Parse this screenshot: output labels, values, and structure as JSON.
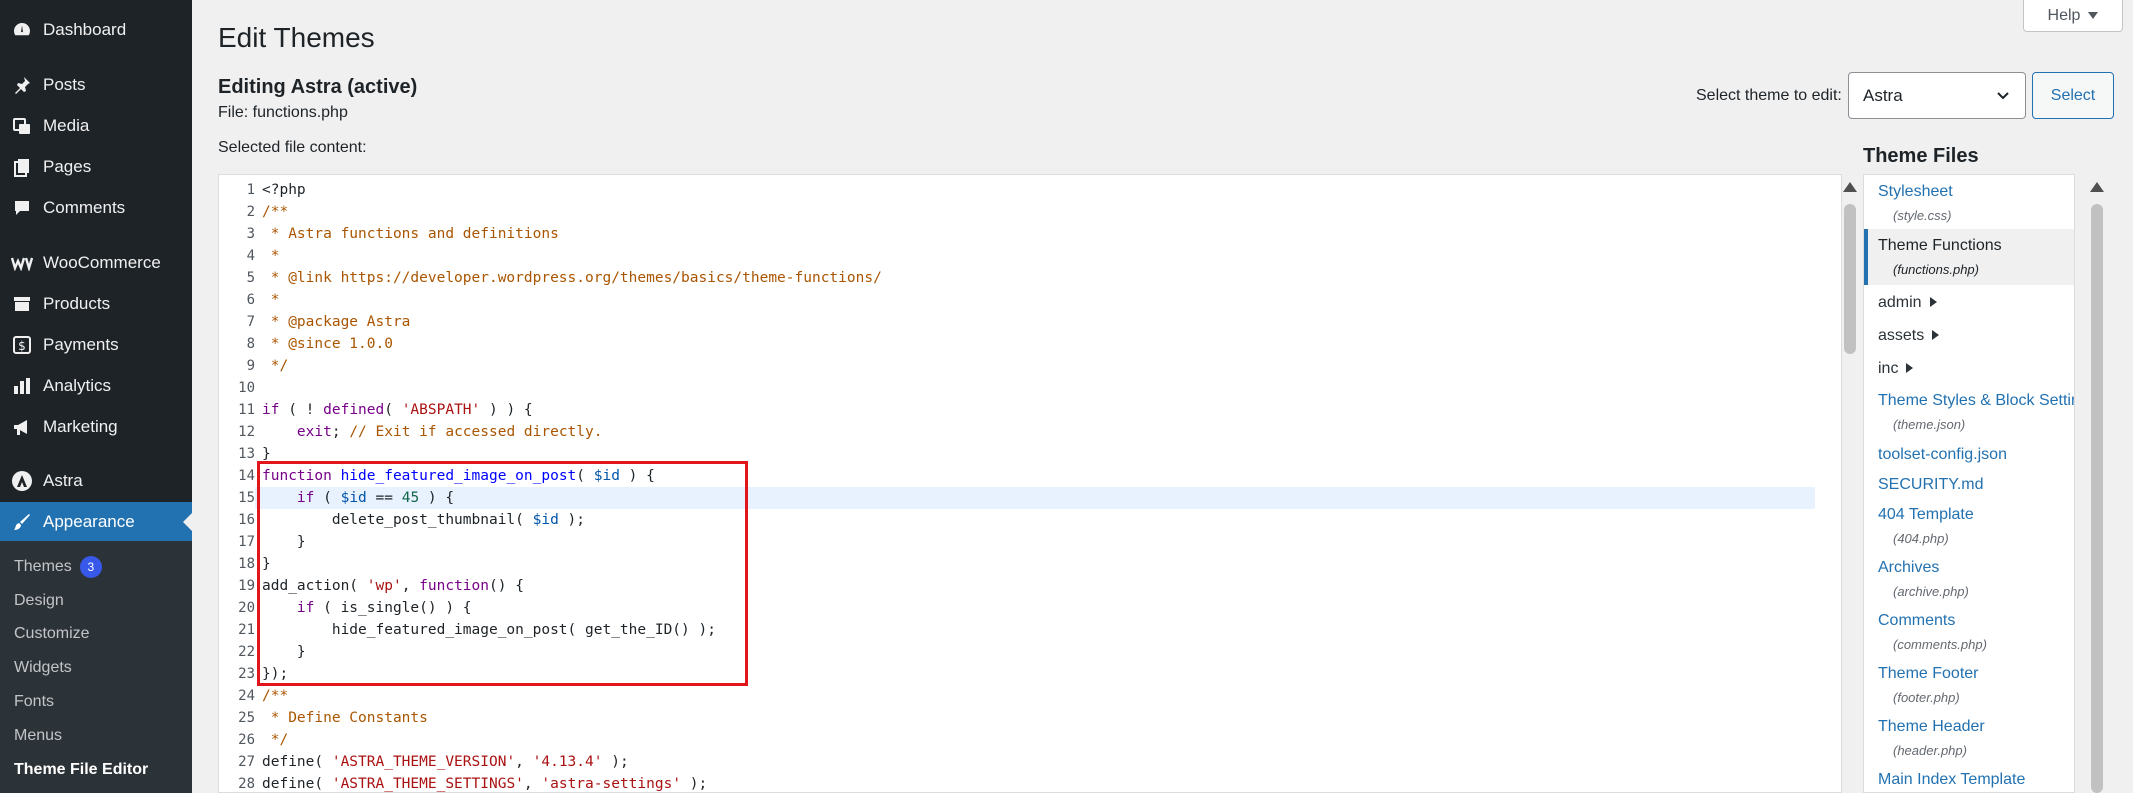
{
  "sidebar": {
    "items": [
      {
        "label": "Dashboard",
        "icon": "dashboard-icon"
      },
      {
        "label": "Posts",
        "icon": "pushpin-icon"
      },
      {
        "label": "Media",
        "icon": "media-icon"
      },
      {
        "label": "Pages",
        "icon": "pages-icon"
      },
      {
        "label": "Comments",
        "icon": "comment-icon"
      },
      {
        "label": "WooCommerce",
        "icon": "woocommerce-icon"
      },
      {
        "label": "Products",
        "icon": "archive-icon"
      },
      {
        "label": "Payments",
        "icon": "payments-icon"
      },
      {
        "label": "Analytics",
        "icon": "bar-chart-icon"
      },
      {
        "label": "Marketing",
        "icon": "megaphone-icon"
      },
      {
        "label": "Astra",
        "icon": "astra-icon"
      },
      {
        "label": "Appearance",
        "icon": "paintbrush-icon"
      }
    ],
    "submenu": [
      {
        "label": "Themes",
        "badge": "3"
      },
      {
        "label": "Design"
      },
      {
        "label": "Customize"
      },
      {
        "label": "Widgets"
      },
      {
        "label": "Fonts"
      },
      {
        "label": "Menus"
      },
      {
        "label": "Theme File Editor"
      }
    ]
  },
  "header": {
    "title": "Edit Themes",
    "help_label": "Help"
  },
  "editor_info": {
    "editing": "Editing Astra (active)",
    "file": "File: functions.php",
    "selected": "Selected file content:"
  },
  "theme_select": {
    "label": "Select theme to edit:",
    "value": "Astra",
    "button": "Select"
  },
  "code": {
    "line_numbers": [
      "1",
      "2",
      "3",
      "4",
      "5",
      "6",
      "7",
      "8",
      "9",
      "10",
      "11",
      "12",
      "13",
      "14",
      "15",
      "16",
      "17",
      "18",
      "19",
      "20",
      "21",
      "22",
      "23",
      "24",
      "25",
      "26",
      "27",
      "28"
    ],
    "l1": "<?php",
    "l2": "/**",
    "l3": " * Astra functions and definitions",
    "l4": " *",
    "l5": " * @link https://developer.wordpress.org/themes/basics/theme-functions/",
    "l6": " *",
    "l7": " * @package Astra",
    "l8": " * @since 1.0.0",
    "l9": " */",
    "l11a": "if",
    "l11b": " ( ! ",
    "l11c": "defined",
    "l11d": "( ",
    "l11e": "'ABSPATH'",
    "l11f": " ) ) {",
    "l12a": "    exit",
    "l12b": "; ",
    "l12c": "// Exit if accessed directly.",
    "l13": "}",
    "l14a": "function",
    "l14b": " hide_featured_image_on_post",
    "l14c": "( ",
    "l14d": "$id",
    "l14e": " ) {",
    "l15a": "    if",
    "l15b": " ( ",
    "l15c": "$id",
    "l15d": " == ",
    "l15e": "45",
    "l15f": " ) {",
    "l16a": "        delete_post_thumbnail( ",
    "l16b": "$id",
    "l16c": " );",
    "l17": "    }",
    "l18": "}",
    "l19a": "add_action( ",
    "l19b": "'wp'",
    "l19c": ", ",
    "l19d": "function",
    "l19e": "() {",
    "l20a": "    if",
    "l20b": " ( is_single() ) {",
    "l21": "        hide_featured_image_on_post( get_the_ID() );",
    "l22": "    }",
    "l23": "});",
    "l24": "/**",
    "l25": " * Define Constants",
    "l26": " */",
    "l27a": "define( ",
    "l27b": "'ASTRA_THEME_VERSION'",
    "l27c": ", ",
    "l27d": "'4.13.4'",
    "l27e": " );",
    "l28a": "define( ",
    "l28b": "'ASTRA_THEME_SETTINGS'",
    "l28c": ", ",
    "l28d": "'astra-settings'",
    "l28e": " );"
  },
  "theme_files": {
    "title": "Theme Files",
    "items": [
      {
        "label": "Stylesheet",
        "file": "(style.css)"
      },
      {
        "label": "Theme Functions",
        "file": "(functions.php)"
      },
      {
        "label": "admin"
      },
      {
        "label": "assets"
      },
      {
        "label": "inc"
      },
      {
        "label": "Theme Styles & Block Settings",
        "file": "(theme.json)"
      },
      {
        "label": "toolset-config.json"
      },
      {
        "label": "SECURITY.md"
      },
      {
        "label": "404 Template",
        "file": "(404.php)"
      },
      {
        "label": "Archives",
        "file": "(archive.php)"
      },
      {
        "label": "Comments",
        "file": "(comments.php)"
      },
      {
        "label": "Theme Footer",
        "file": "(footer.php)"
      },
      {
        "label": "Theme Header",
        "file": "(header.php)"
      },
      {
        "label": "Main Index Template"
      }
    ]
  },
  "colors": {
    "sidebar_bg": "#1d2327",
    "accent": "#2271b1",
    "highlight_box": "#e0161b"
  }
}
